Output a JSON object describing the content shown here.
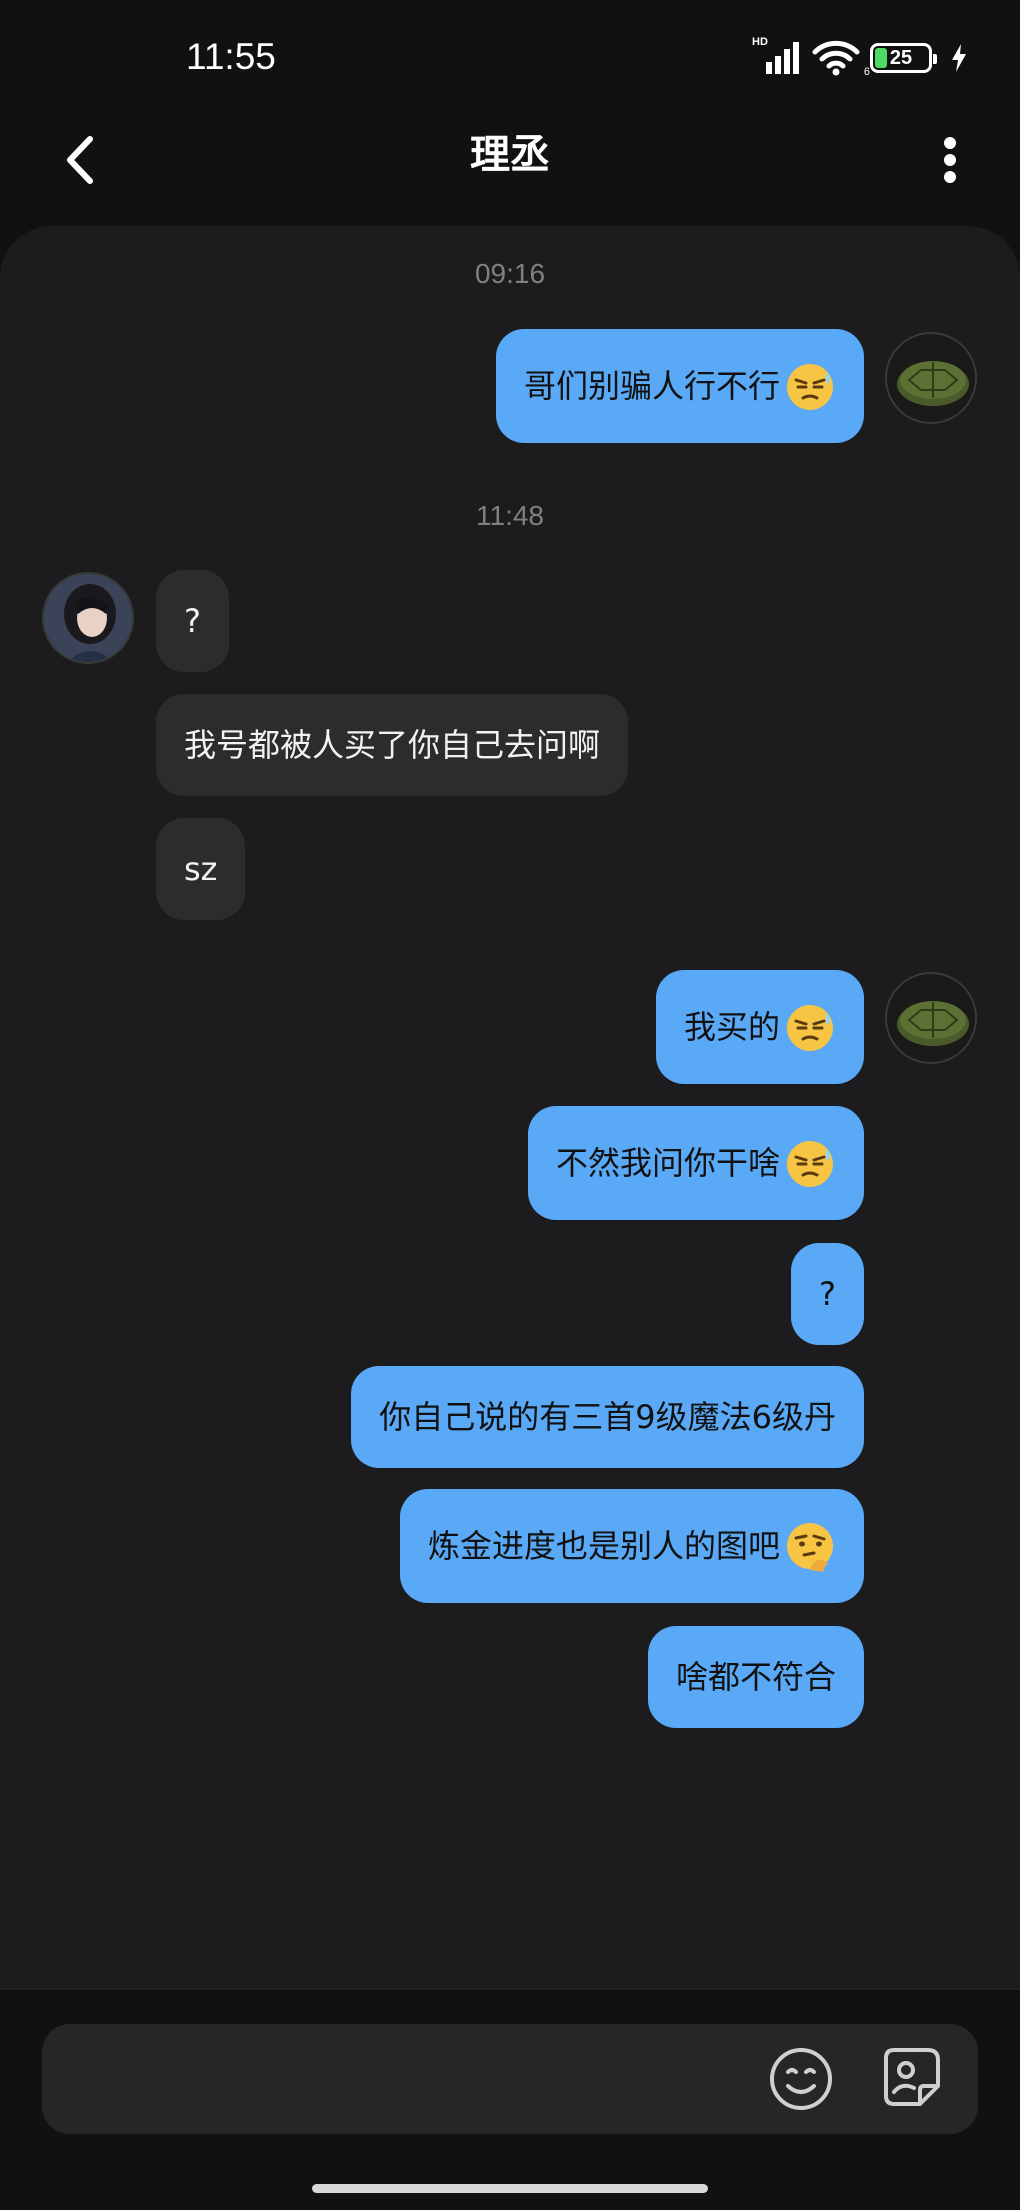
{
  "status_bar": {
    "time": "11:55",
    "network_label": "HD",
    "wifi_label": "6",
    "battery_level": "25",
    "battery_color": "#4cd964"
  },
  "header": {
    "title": "理丞",
    "back_icon": "chevron-left-icon",
    "more_icon": "more-vertical-icon"
  },
  "chat": {
    "colors": {
      "outgoing": "#5aa9f7",
      "incoming": "#2c2c2e",
      "panel": "#1c1c1e"
    },
    "timestamps": [
      "09:16",
      "11:48"
    ],
    "messages": [
      {
        "from": "self",
        "text": "哥们别骗人行不行",
        "emoji": "sweat-smug-emoji"
      },
      {
        "from": "other",
        "text": "?"
      },
      {
        "from": "other",
        "text": "我号都被人买了你自己去问啊"
      },
      {
        "from": "other",
        "text": "sz"
      },
      {
        "from": "self",
        "text": "我买的",
        "emoji": "sweat-smug-emoji"
      },
      {
        "from": "self",
        "text": "不然我问你干啥",
        "emoji": "sweat-smug-emoji"
      },
      {
        "from": "self",
        "text": "?"
      },
      {
        "from": "self",
        "text": "你自己说的有三首9级魔法6级丹"
      },
      {
        "from": "self",
        "text": "炼金进度也是别人的图吧",
        "emoji": "thinking-emoji"
      },
      {
        "from": "self",
        "text": "啥都不符合"
      }
    ]
  },
  "input": {
    "placeholder": "",
    "emoji_icon": "smile-icon",
    "sticker_icon": "sticker-icon"
  }
}
